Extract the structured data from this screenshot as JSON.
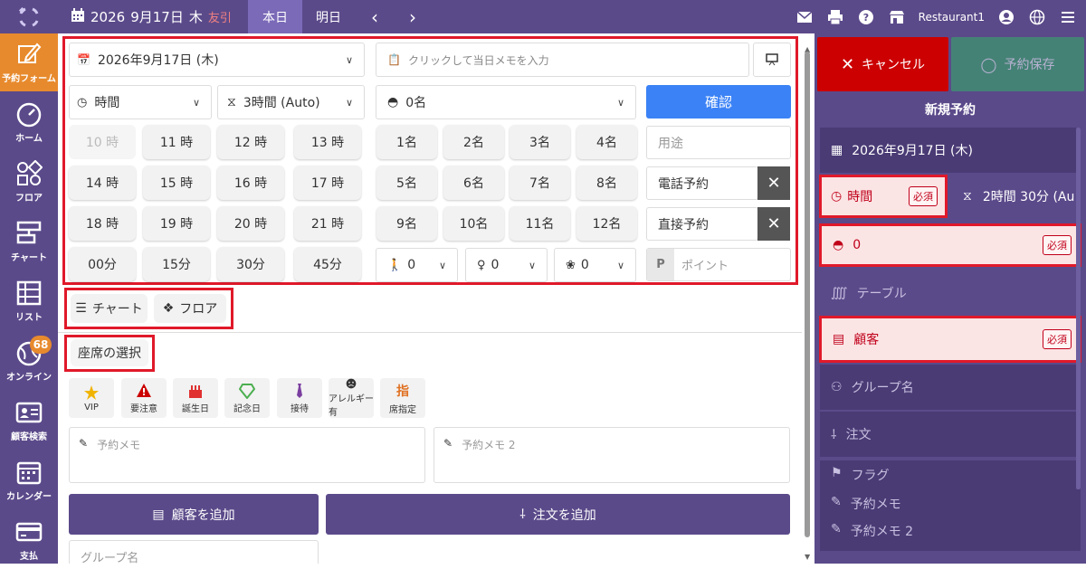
{
  "topbar": {
    "date": "2026",
    "date2": "9月17日",
    "weekday": "木",
    "rokuyo": "友引",
    "today": "本日",
    "tomorrow": "明日",
    "restaurant": "Restaurant1"
  },
  "sidebar": [
    {
      "label": "予約フォーム",
      "icon": "edit-icon"
    },
    {
      "label": "ホーム",
      "icon": "gauge-icon"
    },
    {
      "label": "フロア",
      "icon": "floor-icon"
    },
    {
      "label": "チャート",
      "icon": "chart-icon"
    },
    {
      "label": "リスト",
      "icon": "list-icon"
    },
    {
      "label": "オンライン",
      "icon": "globe-icon",
      "badge": "68"
    },
    {
      "label": "顧客検索",
      "icon": "customer-card-icon"
    },
    {
      "label": "カレンダー",
      "icon": "calendar-icon"
    },
    {
      "label": "支払",
      "icon": "payment-card-icon"
    }
  ],
  "form": {
    "date": "2026年9月17日 (木)",
    "memo_placeholder": "クリックして当日メモを入力",
    "time": "時間",
    "duration": "3時間 (Auto)",
    "people": "0名",
    "confirm": "確認",
    "hours": [
      "10 時",
      "11 時",
      "12 時",
      "13 時",
      "14 時",
      "15 時",
      "16 時",
      "17 時",
      "18 時",
      "19 時",
      "20 時",
      "21 時",
      "00分",
      "15分",
      "30分",
      "45分"
    ],
    "counts": [
      "1名",
      "2名",
      "3名",
      "4名",
      "5名",
      "6名",
      "7名",
      "8名",
      "9名",
      "10名",
      "11名",
      "12名"
    ],
    "purpose_placeholder": "用途",
    "phone": "電話予約",
    "direct": "直接予約",
    "point_placeholder": "ポイント",
    "point_prefix": "P",
    "adult": "0",
    "child": "0",
    "baby": "0"
  },
  "views": {
    "chart": "チャート",
    "floor": "フロア"
  },
  "seat_select": "座席の選択",
  "tags": [
    {
      "label": "VIP",
      "icon": "star-icon",
      "color": "#f0b400"
    },
    {
      "label": "要注意",
      "icon": "warning-icon",
      "color": "#cc0000"
    },
    {
      "label": "誕生日",
      "icon": "cake-icon",
      "color": "#e03030"
    },
    {
      "label": "記念日",
      "icon": "diamond-icon",
      "color": "#4caf50"
    },
    {
      "label": "接待",
      "icon": "tie-icon",
      "color": "#7b3fa0"
    },
    {
      "label": "アレルギー有",
      "icon": "allergy-icon",
      "color": "#333"
    },
    {
      "label": "席指定",
      "icon": "seat-icon",
      "color": "#e07020"
    }
  ],
  "memo1_placeholder": "予約メモ",
  "memo2_placeholder": "予約メモ 2",
  "add_customer": "顧客を追加",
  "add_order": "注文を追加",
  "group_placeholder": "グループ名",
  "right": {
    "cancel": "キャンセル",
    "save": "予約保存",
    "title": "新規予約",
    "date": "2026年9月17日 (木)",
    "time": "時間",
    "required": "必須",
    "duration": "2時間 30分 (Au",
    "people": "0",
    "table": "テーブル",
    "customer": "顧客",
    "group": "グループ名",
    "order": "注文",
    "flag": "フラグ",
    "memo": "予約メモ",
    "memo2": "予約メモ 2"
  }
}
